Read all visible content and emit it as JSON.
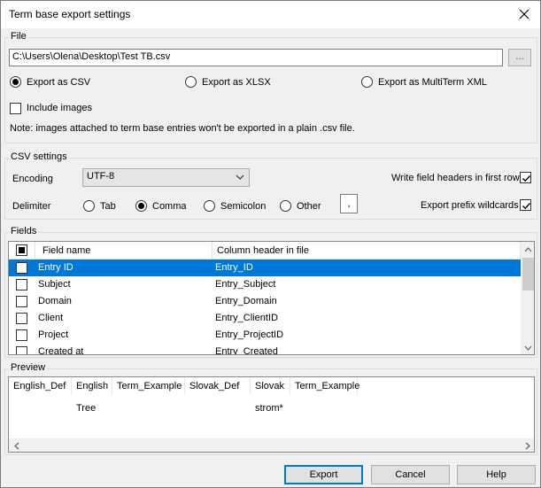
{
  "title": "Term base export settings",
  "file_group": {
    "label": "File",
    "path": "C:\\Users\\Olena\\Desktop\\Test TB.csv",
    "browse_label": "...",
    "formats": [
      "Export as CSV",
      "Export as XLSX",
      "Export as MultiTerm XML"
    ],
    "selected_format": 0,
    "include_images_label": "Include images",
    "include_images_checked": false,
    "note": "Note: images attached to term base entries won't be exported in a plain .csv file."
  },
  "csv_group": {
    "label": "CSV settings",
    "encoding_label": "Encoding",
    "encoding_value": "UTF-8",
    "delimiter_label": "Delimiter",
    "delimiters": [
      "Tab",
      "Comma",
      "Semicolon",
      "Other"
    ],
    "selected_delimiter": 1,
    "other_value": ",",
    "write_headers_label": "Write field headers in first row",
    "write_headers_checked": true,
    "export_prefix_label": "Export prefix wildcards",
    "export_prefix_checked": true
  },
  "fields_group": {
    "label": "Fields",
    "columns": [
      "Field name",
      "Column header in file"
    ],
    "rows": [
      {
        "name": "Entry ID",
        "header": "Entry_ID",
        "checked": false,
        "selected": true
      },
      {
        "name": "Subject",
        "header": "Entry_Subject",
        "checked": false,
        "selected": false
      },
      {
        "name": "Domain",
        "header": "Entry_Domain",
        "checked": false,
        "selected": false
      },
      {
        "name": "Client",
        "header": "Entry_ClientID",
        "checked": false,
        "selected": false
      },
      {
        "name": "Project",
        "header": "Entry_ProjectID",
        "checked": false,
        "selected": false
      },
      {
        "name": "Created at",
        "header": "Entry_Created",
        "checked": false,
        "selected": false
      }
    ]
  },
  "preview_group": {
    "label": "Preview",
    "columns": [
      "English_Def",
      "English",
      "Term_Example",
      "Slovak_Def",
      "Slovak",
      "Term_Example"
    ],
    "row": [
      "",
      "Tree",
      "",
      "",
      "strom*",
      ""
    ]
  },
  "buttons": {
    "export": "Export",
    "cancel": "Cancel",
    "help": "Help"
  }
}
